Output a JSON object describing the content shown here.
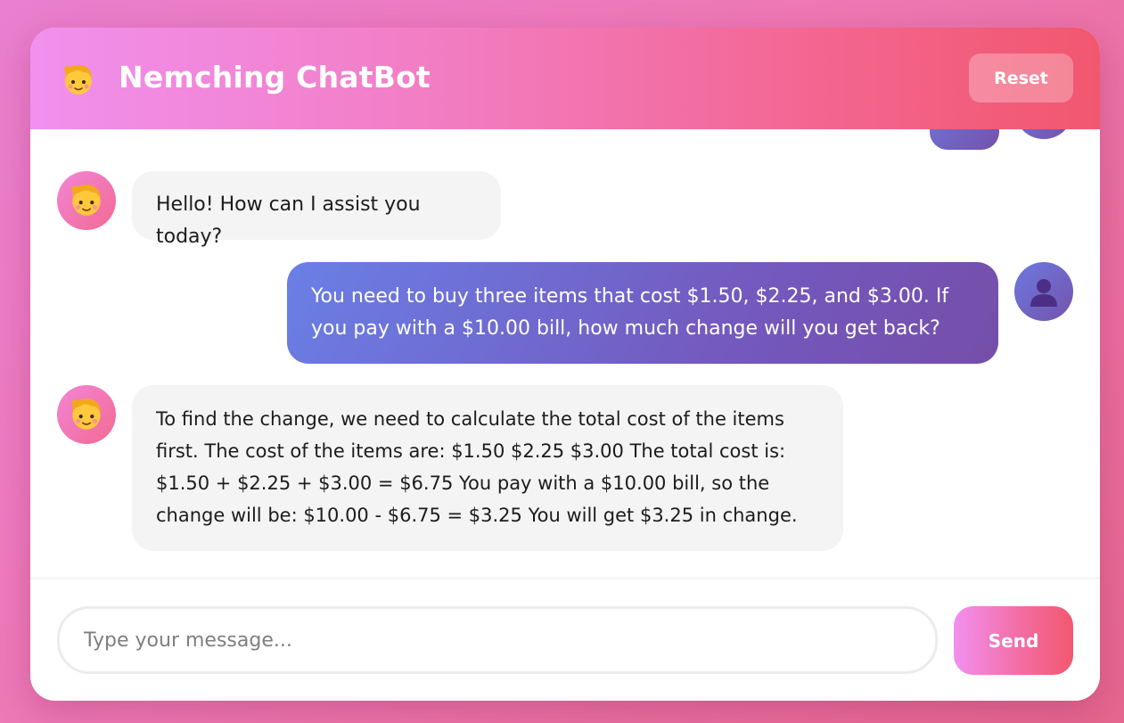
{
  "header": {
    "title": "Nemching ChatBot",
    "reset_label": "Reset",
    "icon": "girl-face-icon"
  },
  "messages": [
    {
      "role": "bot",
      "text": "Hello! How can I assist you today?"
    },
    {
      "role": "user",
      "text": "You need to buy three items that cost $1.50, $2.25, and $3.00. If you pay with a $10.00 bill, how much change will you get back?"
    },
    {
      "role": "bot",
      "text": "To find the change, we need to calculate the total cost of the items first. The cost of the items are: $1.50 $2.25 $3.00 The total cost is: $1.50 + $2.25 + $3.00 = $6.75 You pay with a $10.00 bill, so the change will be: $10.00 - $6.75 = $3.25 You will get $3.25 in change."
    }
  ],
  "composer": {
    "placeholder": "Type your message...",
    "value": "",
    "send_label": "Send"
  },
  "colors": {
    "header_start": "#f190ee",
    "header_end": "#f2576e",
    "user_bubble_start": "#6a7fe6",
    "user_bubble_end": "#754ea9",
    "bot_bubble": "#f4f4f5"
  }
}
